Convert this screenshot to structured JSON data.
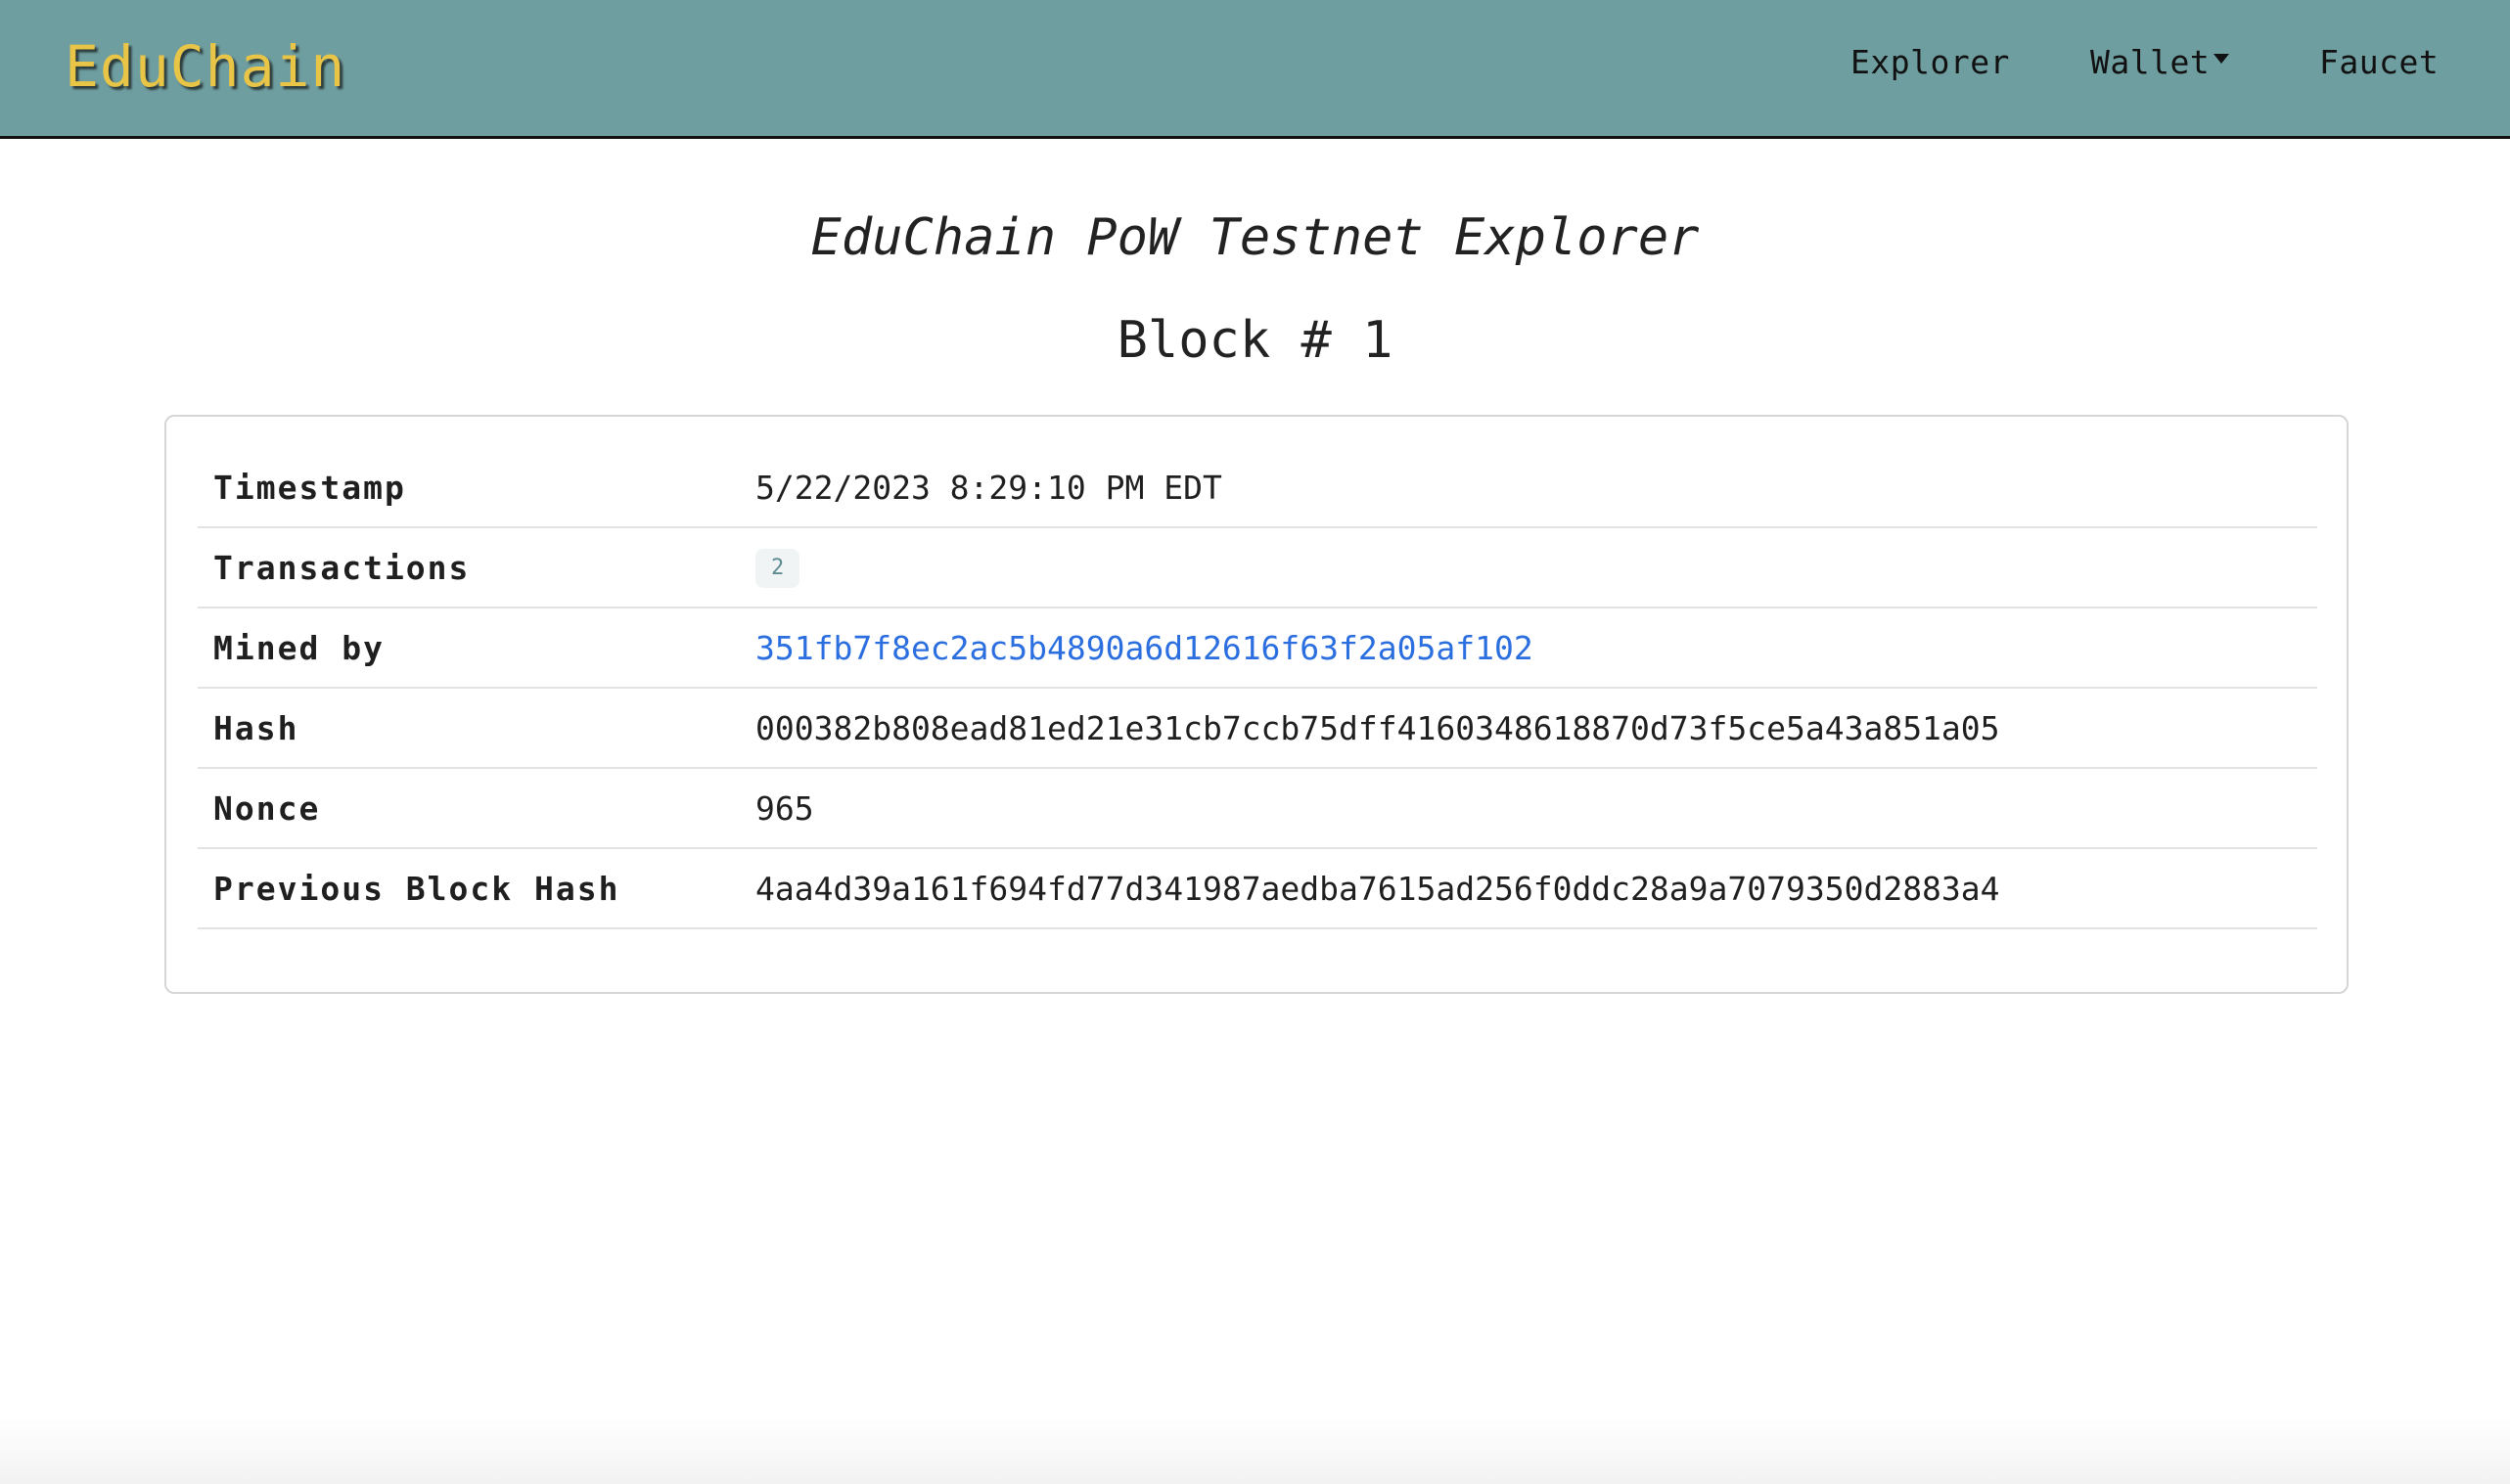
{
  "navbar": {
    "brand": "EduChain",
    "links": {
      "explorer": "Explorer",
      "wallet": "Wallet",
      "faucet": "Faucet"
    }
  },
  "page": {
    "title": "EduChain PoW Testnet Explorer",
    "block_title": "Block # 1"
  },
  "block": {
    "rows": [
      {
        "label": "Timestamp",
        "value": "5/22/2023 8:29:10 PM EDT"
      },
      {
        "label": "Transactions",
        "value": "2"
      },
      {
        "label": "Mined by",
        "value": "351fb7f8ec2ac5b4890a6d12616f63f2a05af102"
      },
      {
        "label": "Hash",
        "value": "000382b808ead81ed21e31cb7ccb75dff4160348618870d73f5ce5a43a851a05"
      },
      {
        "label": "Nonce",
        "value": "965"
      },
      {
        "label": "Previous Block Hash",
        "value": "4aa4d39a161f694fd77d341987aedba7615ad256f0ddc28a9a7079350d2883a4"
      }
    ]
  },
  "colors": {
    "navbar_bg": "#6f9ea0",
    "brand": "#e8c547",
    "link": "#2a6ee0"
  }
}
